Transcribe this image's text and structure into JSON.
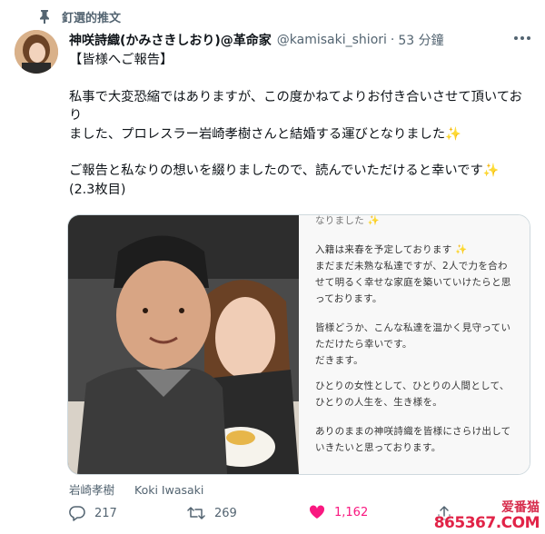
{
  "pinned_label": "釘選的推文",
  "author": {
    "name": "神咲詩織(かみさきしおり)@革命家",
    "handle": "@kamisaki_shiori",
    "time": "53 分鐘"
  },
  "tweet": {
    "lines": [
      "【皆様へご報告】",
      "",
      "私事で大変恐縮ではありますが、この度かねてよりお付き合いさせて頂いており",
      "ました、プロレスラー岩崎孝樹さんと結婚する運びとなりました✨",
      "",
      "ご報告と私なりの想いを綴りましたので、読んでいただけると幸いです✨",
      "(2.3枚目)",
      "",
      "↓↓↓"
    ]
  },
  "letter_lines": [
    "なりました ✨",
    "入籍は来春を予定しております ✨",
    "まだまだ未熟な私達ですが、2人で力を合わ",
    "せて明るく幸せな家庭を築いていけたらと思",
    "っております。",
    "皆様どうか、こんな私達を温かく見守ってい",
    "ただけたら幸いです。",
    "だきます。",
    "ひとりの女性として、ひとりの人間として、",
    "ひとりの人生を、生き様を。",
    "ありのままの神咲詩織を皆様にさらけ出して",
    "いきたいと思っております。"
  ],
  "tags": [
    "岩崎孝樹",
    "Koki Iwasaki"
  ],
  "stats": {
    "replies": "217",
    "retweets": "269",
    "likes": "1,162"
  },
  "watermark": {
    "name": "爱番猫",
    "site": "865367.COM"
  },
  "colors": {
    "like": "#f91880",
    "secondary": "#536471"
  }
}
